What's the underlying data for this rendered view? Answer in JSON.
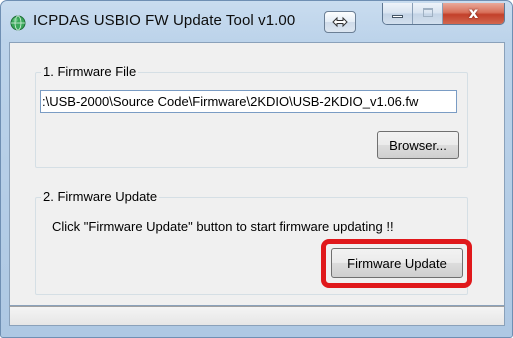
{
  "window": {
    "title": "ICPDAS USBIO FW Update Tool v1.00",
    "icons": {
      "app": "green-globe-icon",
      "swap": "double-arrow-icon",
      "minimize": "minimize-icon",
      "maximize": "maximize-icon",
      "close": "close-icon"
    },
    "close_glyph": "x"
  },
  "firmware_file": {
    "group_label": "1. Firmware File",
    "path_value": ":\\USB-2000\\Source Code\\Firmware\\2KDIO\\USB-2KDIO_v1.06.fw",
    "browse_label": "Browser..."
  },
  "firmware_update": {
    "group_label": "2. Firmware Update",
    "hint": "Click  \"Firmware Update\" button to start firmware updating !!",
    "button_label": "Firmware  Update"
  },
  "colors": {
    "highlight": "#e0181b",
    "close_button": "#c2402a",
    "title_bar": "#bcd3ea"
  }
}
